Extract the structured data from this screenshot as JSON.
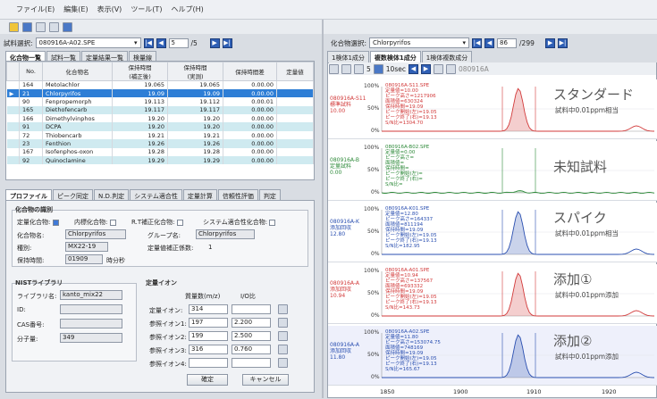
{
  "menu": [
    "ファイル(E)",
    "編集(E)",
    "表示(V)",
    "ツール(T)",
    "ヘルプ(H)"
  ],
  "left_nav": {
    "label": "試料選択:",
    "file": "080916A-A02.SPE",
    "page": "5",
    "total": "/5"
  },
  "right_nav": {
    "label": "化合物選択:",
    "compound": "Chlorpyrifos",
    "page": "86",
    "total": "/299"
  },
  "left_tabs": [
    "化合物一覧",
    "試料一覧",
    "定量結果一覧",
    "検量線"
  ],
  "table": {
    "headers": [
      "No.",
      "化合物名",
      "保持時間\n(補正後)",
      "保持時間\n(実測)",
      "保持時間差",
      "定量値"
    ],
    "rows": [
      [
        "164",
        "Metolachlor",
        "19.065",
        "19.065",
        "0.00.00"
      ],
      [
        "21",
        "Chlorpyrifos",
        "19.09",
        "19.09",
        "0.00.00"
      ],
      [
        "90",
        "Fenpropemorph",
        "19.113",
        "19.112",
        "0.00.01"
      ],
      [
        "165",
        "Diethofencarb",
        "19.117",
        "19.117",
        "0.00.00"
      ],
      [
        "166",
        "Dimethylvinphos",
        "19.20",
        "19.20",
        "0.00.00"
      ],
      [
        "91",
        "DCPA",
        "19.20",
        "19.20",
        "0.00.00"
      ],
      [
        "72",
        "Thiobencarb",
        "19.21",
        "19.21",
        "0.00.00"
      ],
      [
        "23",
        "Fenthion",
        "19.26",
        "19.26",
        "0.00.00"
      ],
      [
        "167",
        "Isofenphos-oxon",
        "19.28",
        "19.28",
        "0.00.00"
      ],
      [
        "92",
        "Quinoclamine",
        "19.29",
        "19.29",
        "0.00.00"
      ]
    ]
  },
  "detail_tabs": [
    "プロファイル",
    "ピーク同定",
    "N.D.判定",
    "システム適合性",
    "定量計算",
    "信頼性評価",
    "判定"
  ],
  "detail": {
    "group_title": "化合物の識別",
    "cb1": "定量化合物:",
    "cb2": "内標化合物:",
    "cb3": "R.T補正化合物:",
    "cb4": "システム適合性化合物:",
    "name_lbl": "化合物名:",
    "name": "Chlorpyrifos",
    "group_lbl": "グループ名:",
    "group": "Chlorpyrifos",
    "kind_lbl": "種別:",
    "kind": "MX22-19",
    "coef_lbl": "定量値補正係数:",
    "coef": "1",
    "rt_lbl": "保持時間:",
    "rt": "01909",
    "rt_unit": "時分秒",
    "nist_title": "NISTライブラリ",
    "lib_lbl": "ライブラリ名:",
    "lib": "kanto_mix22",
    "id_lbl": "ID:",
    "cas_lbl": "CAS番号:",
    "mw_lbl": "分子量:",
    "mw": "349",
    "ion_title": "定量イオン",
    "mass_hdr": "質量数(m/z)",
    "ratio_hdr": "I/O比",
    "ions": [
      [
        "定量イオン:",
        "314",
        ""
      ],
      [
        "参照イオン1:",
        "197",
        "2.200"
      ],
      [
        "参照イオン2:",
        "199",
        "2.500"
      ],
      [
        "参照イオン3:",
        "316",
        "0.760"
      ],
      [
        "参照イオン4:",
        "",
        ""
      ]
    ],
    "ok": "確定",
    "cancel": "キャンセル"
  },
  "right_tabs": [
    "1検体1成分",
    "複数検体1成分",
    "1検体複数成分"
  ],
  "chart_toolbar": {
    "num": "5",
    "interval": "10sec",
    "file": "080916A"
  },
  "lanes": [
    {
      "name": "080916A-S11\n標準試料\n10.00",
      "file": "080916A-S11.SPE",
      "ann": [
        "定量値=10.00",
        "ピーク高さ=1217906",
        "面積値=630324",
        "保持時間=19.09",
        "ピーク開始(左)=19.05",
        "ピーク終了(右)=19.13",
        "S/N比=1304.70"
      ],
      "big": "スタンダード",
      "small": "試料中0.01ppm相当",
      "color": "#d23a3a"
    },
    {
      "name": "080916A-B\n定量試料\n0.00",
      "file": "080916A-B02.SPE",
      "ann": [
        "定量値=0.00",
        "ピーク高さ=",
        "面積値=",
        "保持時間=",
        "ピーク開始(左)=",
        "ピーク終了(右)=",
        "S/N比="
      ],
      "big": "未知試料",
      "small": "",
      "color": "#2e8a3a"
    },
    {
      "name": "080916A-K\n添加回収\n12.80",
      "file": "080916A-K01.SPE",
      "ann": [
        "定量値=12.80",
        "ピーク高さ=164337",
        "面積値=811194",
        "保持時間=19.09",
        "ピーク開始(左)=19.05",
        "ピーク終了(右)=19.13",
        "S/N比=182.95"
      ],
      "big": "スパイク",
      "small": "試料中0.01ppm相当",
      "color": "#2a4fb0"
    },
    {
      "name": "080916A-A\n添加回収\n10.94",
      "file": "080916A-A01.SPE",
      "ann": [
        "定量値=10.94",
        "ピーク高さ=137567",
        "面積値=693332",
        "保持時間=19.09",
        "ピーク開始(左)=19.05",
        "ピーク終了(右)=19.13",
        "S/N比=143.73"
      ],
      "big": "添加①",
      "small": "試料中0.01ppm添加",
      "color": "#d23a3a"
    },
    {
      "name": "080916A-A\n添加回収\n11.80",
      "file": "080916A-A02.SPE",
      "ann": [
        "定量値=11.80",
        "ピーク高さ=153074.75",
        "面積値=748169",
        "保持時間=19.09",
        "ピーク開始(左)=19.05",
        "ピーク終了(右)=19.13",
        "S/N比=165.67"
      ],
      "big": "添加②",
      "small": "試料中0.01ppm添加",
      "color": "#2a4fb0"
    }
  ],
  "ylabels": [
    "100%",
    "50%",
    "0%"
  ],
  "xaxis": [
    "1850",
    "1900",
    "1910",
    "1920"
  ]
}
